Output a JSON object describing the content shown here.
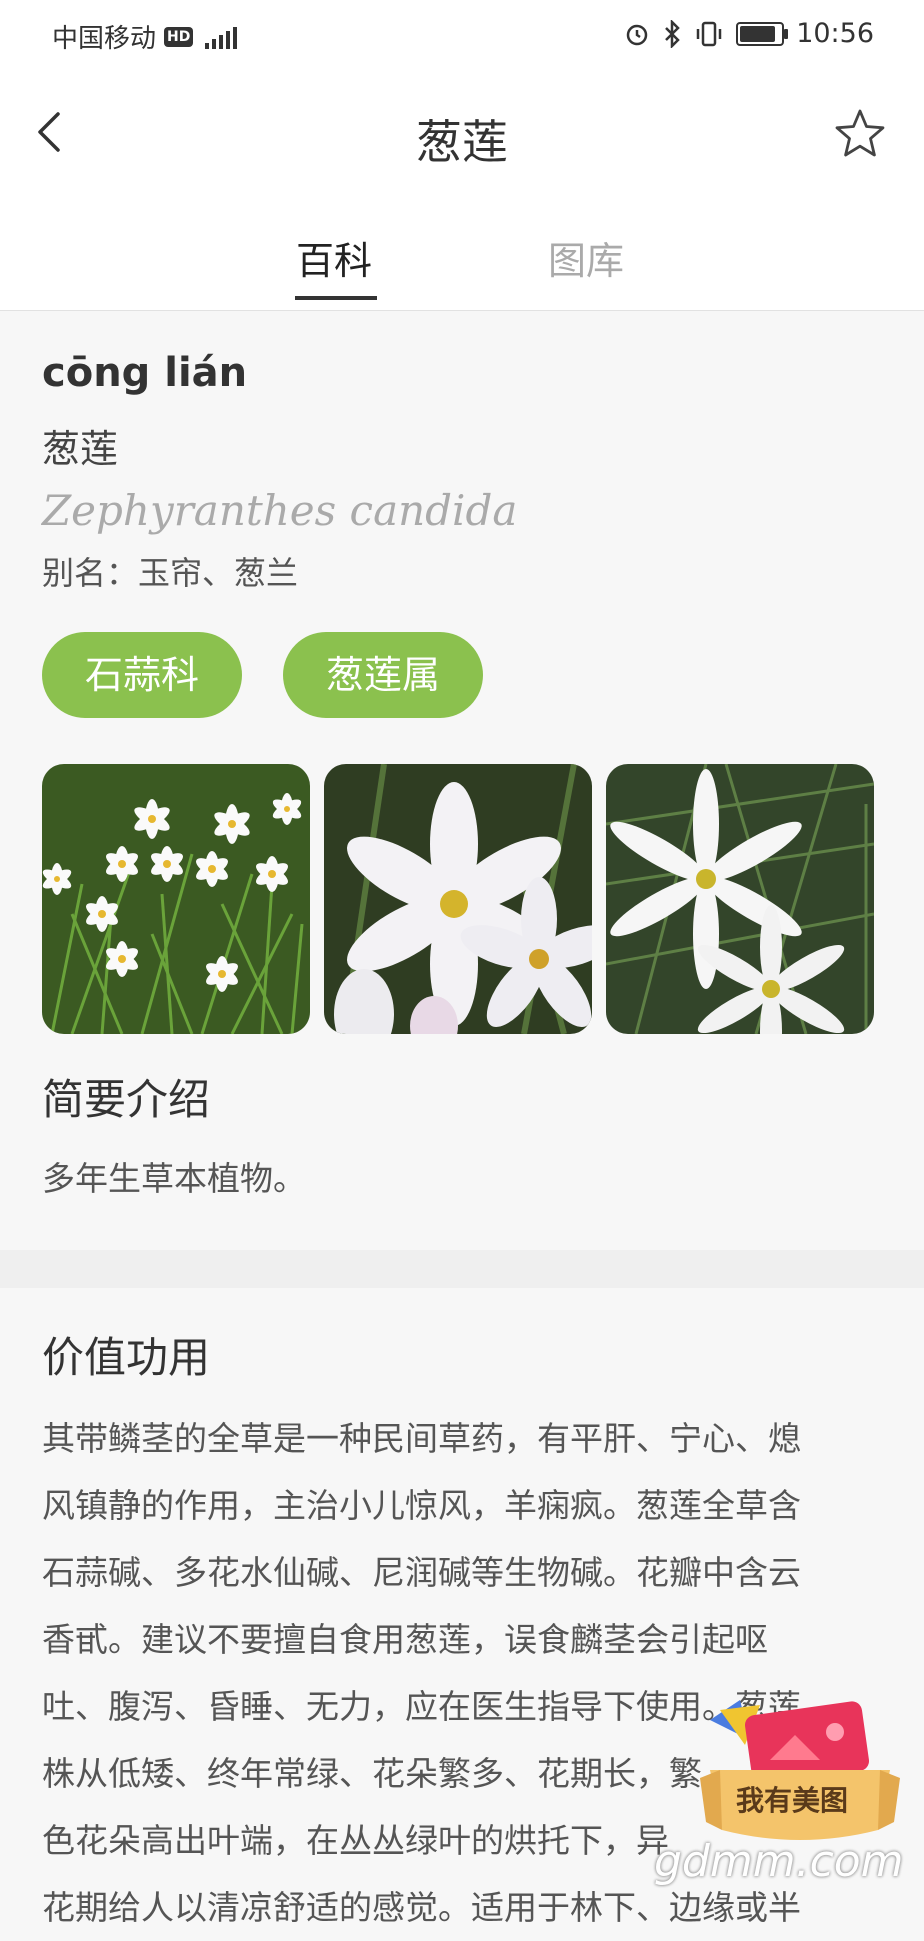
{
  "status_bar": {
    "carrier": "中国移动",
    "hd_badge": "HD",
    "time": "10:56"
  },
  "header": {
    "title": "葱莲",
    "tabs": [
      {
        "label": "百科",
        "active": true
      },
      {
        "label": "图库",
        "active": false
      }
    ]
  },
  "plant": {
    "pinyin": "cōng lián",
    "name": "葱莲",
    "latin_name": "Zephyranthes candida",
    "alias": "别名：玉帘、葱兰",
    "tags": [
      "石蒜科",
      "葱莲属"
    ]
  },
  "intro": {
    "title": "简要介绍",
    "text": "多年生草本植物。"
  },
  "value": {
    "title": "价值功用",
    "lines": [
      "其带鳞茎的全草是一种民间草药，有平肝、宁心、熄",
      "风镇静的作用，主治小儿惊风，羊痫疯。葱莲全草含",
      "石蒜碱、多花水仙碱、尼润碱等生物碱。花瓣中含云",
      "香甙。建议不要擅自食用葱莲，误食麟茎会引起呕",
      "吐、腹泻、昏睡、无力，应在医生指导下使用。葱莲",
      "株从低矮、终年常绿、花朵繁多、花期长，繁",
      "色花朵高出叶端，在丛丛绿叶的烘托下，异",
      "花期给人以清凉舒适的感觉。适用于林下、边缘或半"
    ]
  },
  "overlay": {
    "badge_text": "我有美图",
    "watermark": "gdmm.com"
  },
  "colors": {
    "accent_green": "#8bc14e",
    "tab_inactive": "#aaaaaa"
  },
  "icons": [
    "back-arrow-icon",
    "star-icon",
    "alarm-icon",
    "bluetooth-icon",
    "vibrate-icon",
    "battery-icon",
    "signal-icon"
  ]
}
